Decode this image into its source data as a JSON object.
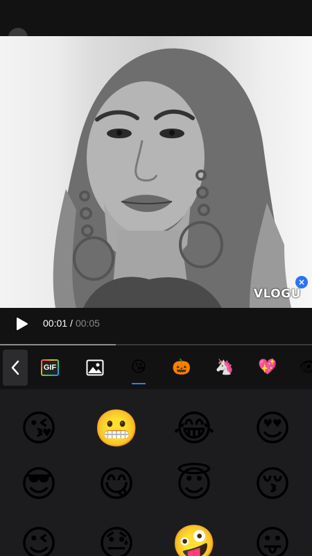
{
  "preview": {
    "watermark": "VLOGU",
    "watermark_close": "×"
  },
  "player": {
    "current_time": "00:01",
    "separator": "/",
    "total_time": "00:05",
    "progress": 0.37
  },
  "tabs": [
    {
      "name": "gif",
      "label": "GIF"
    },
    {
      "name": "image",
      "label": ""
    },
    {
      "name": "emoji",
      "glyph": "😘",
      "selected": true
    },
    {
      "name": "halloween",
      "glyph": "🎃"
    },
    {
      "name": "unicorn",
      "glyph": "🦄"
    },
    {
      "name": "heart",
      "glyph": "💖"
    },
    {
      "name": "more",
      "glyph": "👁"
    }
  ],
  "emojis": [
    {
      "name": "kissing-winking-face",
      "glyph": "😘"
    },
    {
      "name": "grimacing-face",
      "glyph": "😬"
    },
    {
      "name": "tears-of-joy-face",
      "glyph": "😂"
    },
    {
      "name": "heart-eyes-face",
      "glyph": "😍"
    },
    {
      "name": "sunglasses-face",
      "glyph": "😎"
    },
    {
      "name": "savoring-food-face",
      "glyph": "😋"
    },
    {
      "name": "halo-face",
      "glyph": "😇"
    },
    {
      "name": "kissing-closed-eyes-face",
      "glyph": "😚"
    },
    {
      "name": "winking-face",
      "glyph": "😉"
    },
    {
      "name": "downcast-sweat-face",
      "glyph": "😓"
    },
    {
      "name": "zany-face",
      "glyph": "🤪"
    },
    {
      "name": "tongue-out-face",
      "glyph": "😛"
    }
  ],
  "colors": {
    "accent": "#2f7df6",
    "background": "#1c1c1e",
    "bar": "#121212"
  }
}
